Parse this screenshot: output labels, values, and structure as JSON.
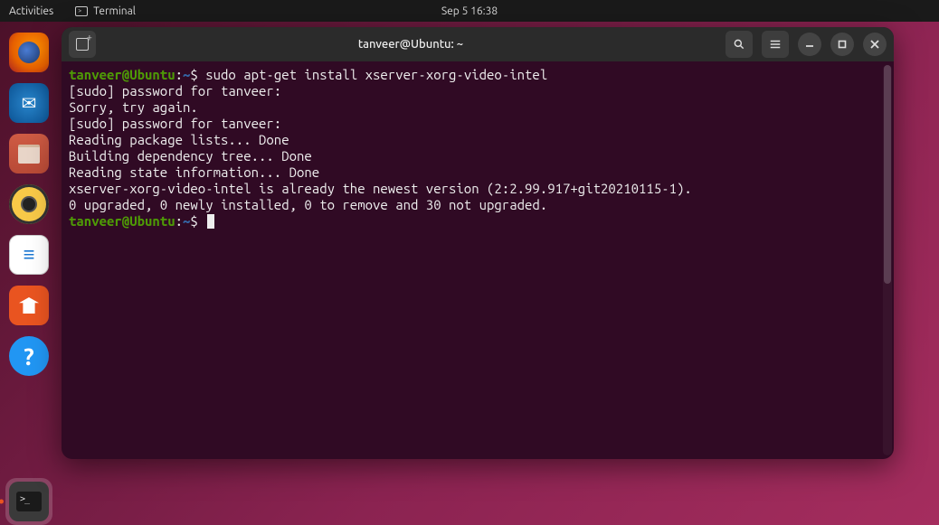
{
  "topbar": {
    "activities": "Activities",
    "terminal_label": "Terminal",
    "datetime": "Sep 5  16:38"
  },
  "dock": {
    "items": [
      {
        "name": "firefox"
      },
      {
        "name": "thunderbird"
      },
      {
        "name": "files"
      },
      {
        "name": "rhythmbox"
      },
      {
        "name": "libreoffice-writer"
      },
      {
        "name": "ubuntu-software"
      },
      {
        "name": "help"
      }
    ],
    "active": {
      "name": "terminal"
    }
  },
  "window": {
    "title": "tanveer@Ubuntu: ~",
    "buttons": {
      "new_tab": "new-tab",
      "search": "search",
      "menu": "menu",
      "minimize": "minimize",
      "maximize": "maximize",
      "close": "close"
    }
  },
  "terminal": {
    "prompt_user_host": "tanveer@Ubuntu",
    "prompt_sep": ":",
    "prompt_path": "~",
    "prompt_symbol": "$",
    "lines": [
      {
        "type": "cmd",
        "text": "sudo apt-get install xserver-xorg-video-intel"
      },
      {
        "type": "out",
        "text": "[sudo] password for tanveer: "
      },
      {
        "type": "out",
        "text": "Sorry, try again."
      },
      {
        "type": "out",
        "text": "[sudo] password for tanveer: "
      },
      {
        "type": "out",
        "text": "Reading package lists... Done"
      },
      {
        "type": "out",
        "text": "Building dependency tree... Done"
      },
      {
        "type": "out",
        "text": "Reading state information... Done"
      },
      {
        "type": "out",
        "text": "xserver-xorg-video-intel is already the newest version (2:2.99.917+git20210115-1)."
      },
      {
        "type": "out",
        "text": "0 upgraded, 0 newly installed, 0 to remove and 30 not upgraded."
      },
      {
        "type": "prompt",
        "text": ""
      }
    ]
  }
}
